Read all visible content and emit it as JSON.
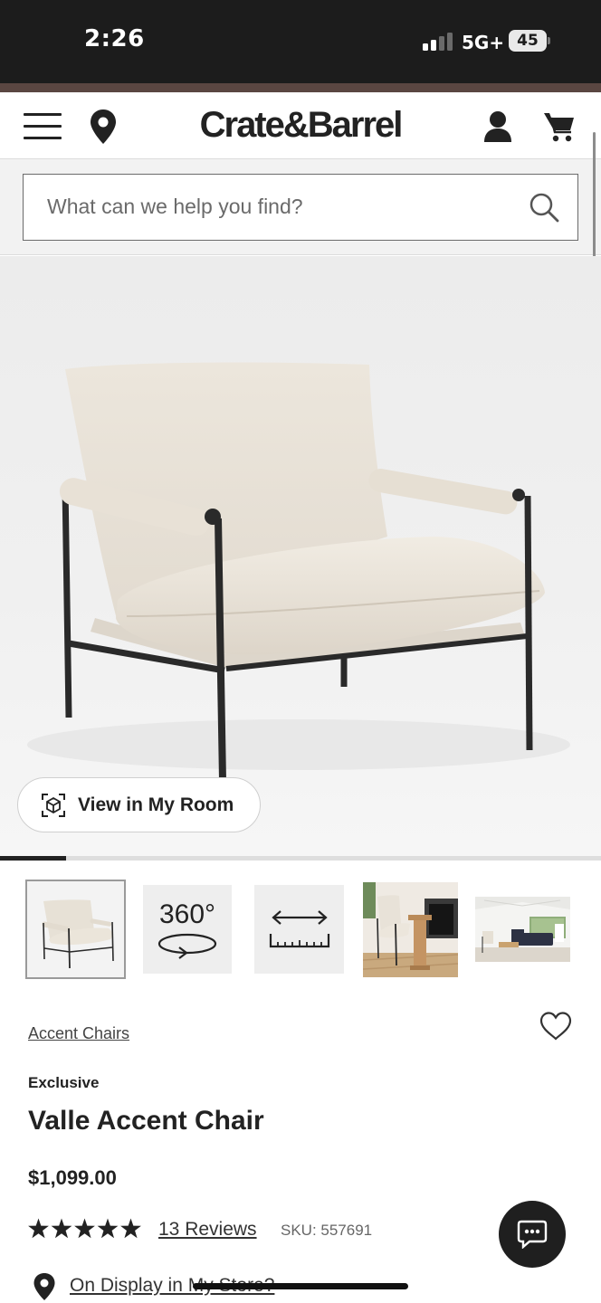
{
  "status_bar": {
    "time": "2:26",
    "network": "5G+",
    "battery": "45"
  },
  "header": {
    "logo": "Crate&Barrel",
    "menu_icon": "hamburger-menu-icon",
    "location_icon": "location-pin-icon",
    "account_icon": "account-icon",
    "cart_icon": "cart-icon"
  },
  "search": {
    "placeholder": "What can we help you find?",
    "value": "",
    "icon": "search-icon"
  },
  "gallery": {
    "view_in_room_label": "View in My Room",
    "view_in_room_icon": "ar-cube-icon",
    "progress_fraction": 0.11,
    "thumbnails": [
      {
        "kind": "product-photo",
        "selected": true
      },
      {
        "kind": "360-view",
        "label": "360°"
      },
      {
        "kind": "dimensions",
        "icon": "dimensions-ruler-icon"
      },
      {
        "kind": "room-photo-dining"
      },
      {
        "kind": "room-photo-living"
      }
    ]
  },
  "product": {
    "category": "Accent Chairs",
    "badge": "Exclusive",
    "title": "Valle Accent Chair",
    "price": "$1,099.00",
    "rating": 5,
    "rating_max": 5,
    "reviews": "13 Reviews",
    "sku": "SKU: 557691",
    "store_link": "On Display in My Store?",
    "wishlist_icon": "heart-icon"
  },
  "chat": {
    "icon": "chat-bubble-icon"
  },
  "colors": {
    "status_bar_bg": "#1c1c1c",
    "accent_strip": "#5a4641",
    "text_primary": "#222222",
    "search_area_bg": "#f2f2f2"
  }
}
